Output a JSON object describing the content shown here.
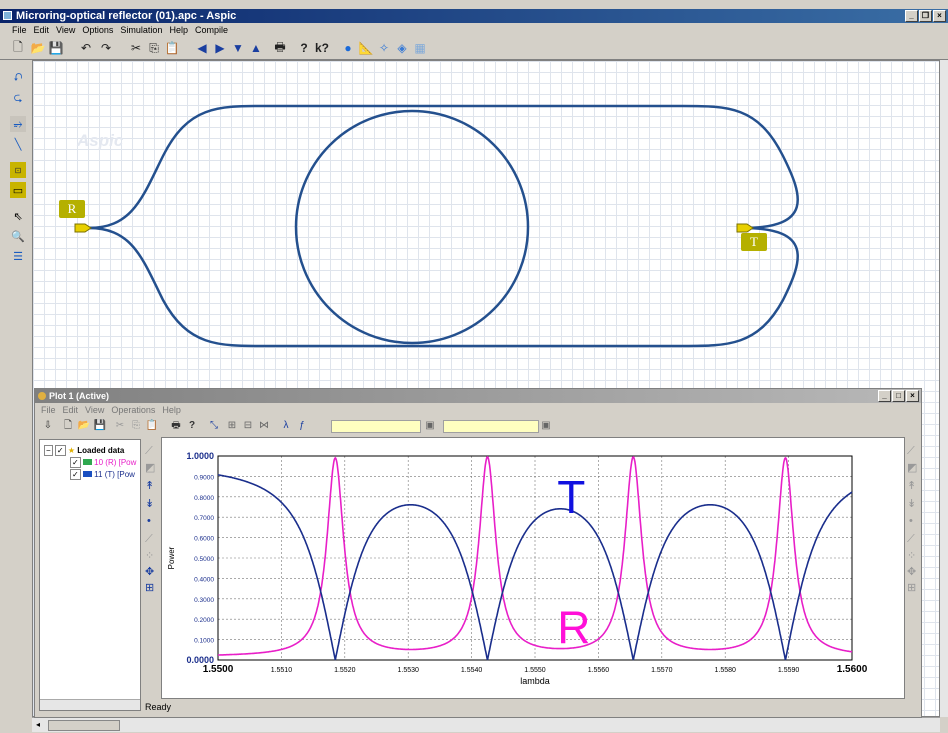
{
  "window": {
    "title": "Microring-optical reflector (01).apc - Aspic"
  },
  "menu": [
    "File",
    "Edit",
    "View",
    "Options",
    "Simulation",
    "Help",
    "Compile"
  ],
  "canvas": {
    "watermark": "Aspic",
    "port_in": "R",
    "port_out": "T"
  },
  "plot_window": {
    "title": "Plot 1 (Active)",
    "menu": [
      "File",
      "Edit",
      "View",
      "Operations",
      "Help"
    ],
    "tree": {
      "root": "Loaded data",
      "items": [
        "10 (R) [Pow",
        "11 (T) [Pow"
      ]
    },
    "status": "Ready"
  },
  "chart_data": {
    "type": "line",
    "xlabel": "lambda",
    "ylabel": "Power",
    "xlim": [
      1.55,
      1.56
    ],
    "ylim": [
      0,
      1
    ],
    "x_ticks": [
      "1.5500",
      "1.5510",
      "1.5520",
      "1.5530",
      "1.5540",
      "1.5550",
      "1.5560",
      "1.5570",
      "1.5580",
      "1.5590",
      "1.5600"
    ],
    "y_ticks": [
      "0.0000",
      "0.1000",
      "0.2000",
      "0.3000",
      "0.4000",
      "0.5000",
      "0.6000",
      "0.7000",
      "0.8000",
      "0.9000",
      "1.0000"
    ],
    "grid": true,
    "resonances": [
      1.55185,
      1.55425,
      1.55655,
      1.55895
    ],
    "series": [
      {
        "name": "T",
        "color": "#1a2e8c",
        "baseline": 0.97,
        "dip": 0.0
      },
      {
        "name": "R",
        "color": "#e81fc8",
        "baseline": 0.03,
        "peak": 1.0
      }
    ],
    "annotations": [
      {
        "text": "T",
        "color": "#1010e0"
      },
      {
        "text": "R",
        "color": "#ff10d8"
      }
    ]
  }
}
